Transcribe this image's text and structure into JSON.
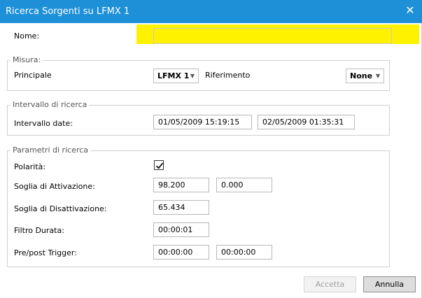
{
  "dialog": {
    "title": "Ricerca Sorgenti su LFMX 1",
    "name_label": "Nome:",
    "name_value": ""
  },
  "misura": {
    "legend": "Misura:",
    "principale_label": "Principale",
    "principale_value": "LFMX 1",
    "riferimento_label": "Riferimento",
    "riferimento_value": "None"
  },
  "intervallo": {
    "legend": "Intervallo di ricerca",
    "date_label": "Intervallo date:",
    "start": "01/05/2009 15:19:15",
    "end": "02/05/2009 01:35:31"
  },
  "parametri": {
    "legend": "Parametri di ricerca",
    "polarita_label": "Polarità:",
    "polarita_checked": true,
    "attivazione_label": "Soglia di Attivazione:",
    "attivazione_1": "98.200",
    "attivazione_2": "0.000",
    "disattivazione_label": "Soglia di Disattivazione:",
    "disattivazione": "65.434",
    "filtro_label": "Filtro Durata:",
    "filtro": "00:00:01",
    "trigger_label": "Pre/post Trigger:",
    "pre": "00:00:00",
    "post": "00:00:00"
  },
  "buttons": {
    "accetta": "Accetta",
    "annulla": "Annulla"
  },
  "colors": {
    "titlebar": "#1e90d8",
    "highlight": "#fff200"
  },
  "icons": {
    "close": "close-icon",
    "dropdown": "chevron-down-icon",
    "check": "checkmark-icon"
  }
}
